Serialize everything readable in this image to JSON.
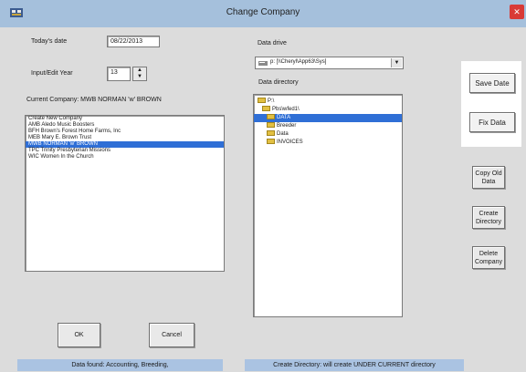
{
  "window": {
    "title": "Change Company"
  },
  "left": {
    "todays_date_label": "Today's date",
    "todays_date_value": "08/22/2013",
    "input_year_label": "Input/Edit Year",
    "input_year_value": "13",
    "current_company_label": "Current Company: MWB NORMAN 'w' BROWN",
    "companies": [
      {
        "text": "Create New Company",
        "selected": false
      },
      {
        "text": "AMB  Aledo Music Boosters",
        "selected": false
      },
      {
        "text": "BFH  Brown's Forest Home Farms, Inc",
        "selected": false
      },
      {
        "text": "MEB  Mary E. Brown Trust",
        "selected": false
      },
      {
        "text": "MWB  NORMAN 'w' BROWN",
        "selected": true
      },
      {
        "text": "TPC  Trinity Presbyterian Missions",
        "selected": false
      },
      {
        "text": "WIC  Women In the Church",
        "selected": false
      }
    ]
  },
  "middle": {
    "data_drive_label": "Data drive",
    "data_drive_value": "p: [\\\\Cheryl\\App63\\Sys]",
    "data_directory_label": "Data directory",
    "directories": [
      {
        "text": "P:\\",
        "indent": 0,
        "selected": false
      },
      {
        "text": "Pbs\\wfed1\\",
        "indent": 1,
        "selected": false
      },
      {
        "text": "DATA",
        "indent": 2,
        "selected": true
      },
      {
        "text": "Breeder",
        "indent": 2,
        "selected": false
      },
      {
        "text": "Data",
        "indent": 2,
        "selected": false
      },
      {
        "text": "INVOICES",
        "indent": 2,
        "selected": false
      }
    ]
  },
  "buttons": {
    "save_date": "Save Date",
    "fix_data": "Fix Data",
    "copy_old_data": "Copy Old Data",
    "create_directory": "Create Directory",
    "delete_company": "Delete Company",
    "ok": "OK",
    "cancel": "Cancel"
  },
  "status": {
    "left": "Data found: Accounting, Breeding,",
    "right": "Create Directory: will create UNDER CURRENT directory"
  },
  "colors": {
    "titlebar": "#a5c0dc",
    "selection": "#2f6fd6",
    "close": "#d93a36"
  }
}
